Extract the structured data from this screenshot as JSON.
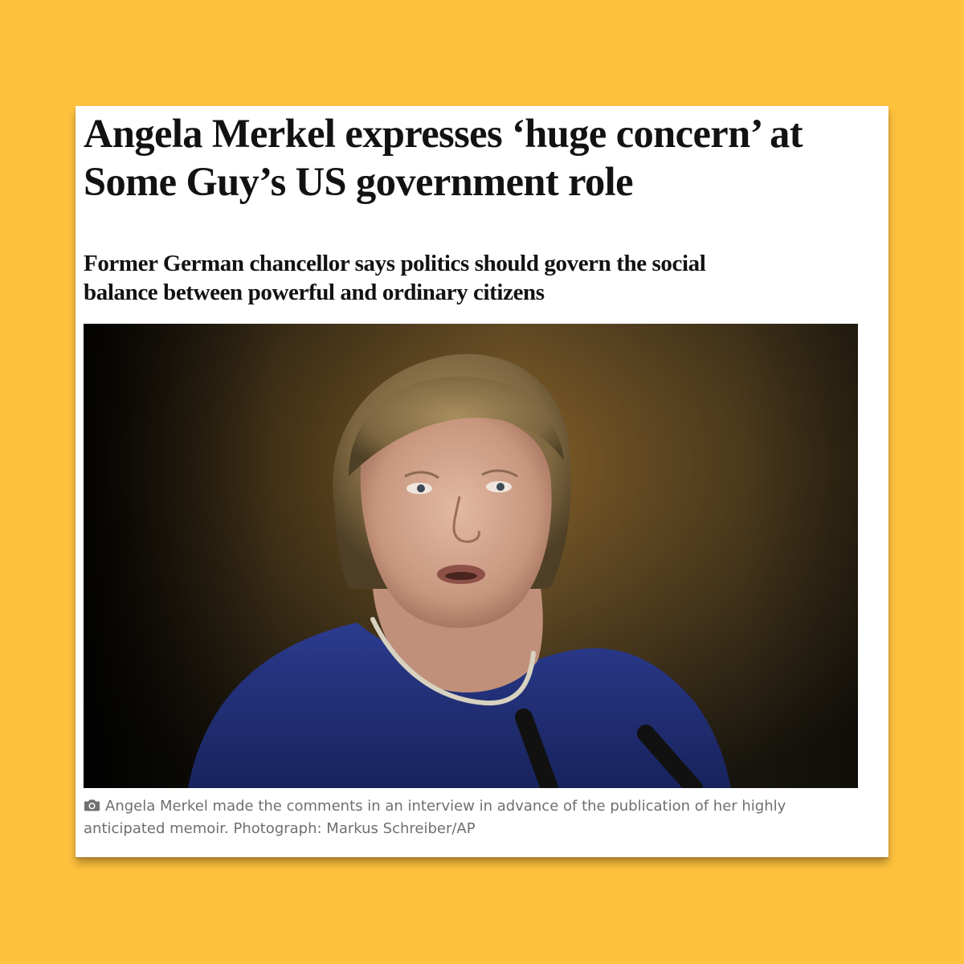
{
  "article": {
    "headline": "Angela Merkel expresses ‘huge concern’ at Some Guy’s US government role",
    "standfirst": "Former German chancellor says politics should govern the social balance between powerful and ordinary citizens",
    "caption": "Angela Merkel made the comments in an interview in advance of the publication of her highly anticipated memoir. Photograph: Markus Schreiber/AP",
    "caption_icon": "camera-icon"
  },
  "colors": {
    "background": "#ffc23d",
    "card": "#ffffff",
    "headline_text": "#121212",
    "caption_text": "#6f6f6f"
  }
}
